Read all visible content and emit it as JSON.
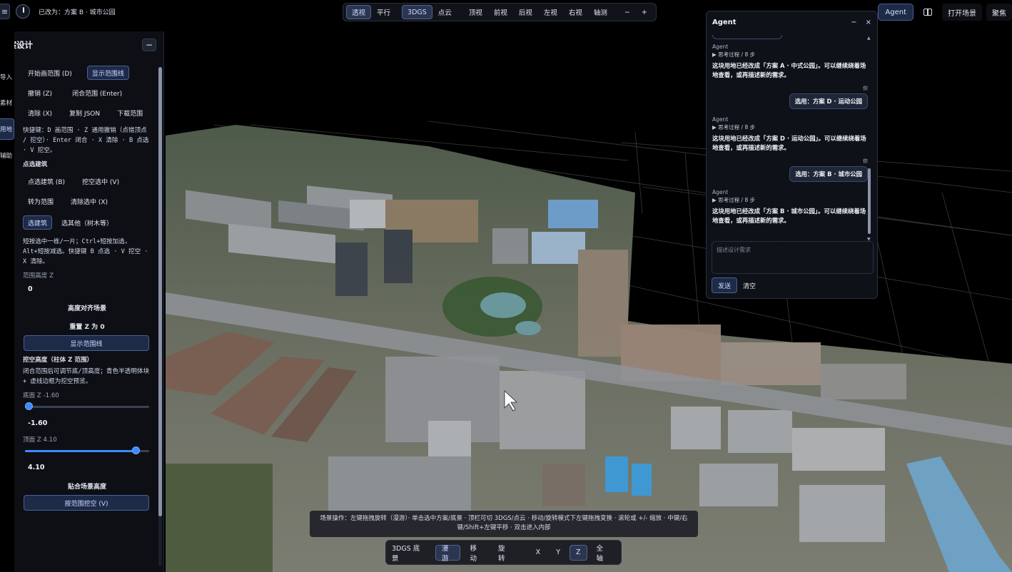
{
  "topbar": {
    "status_text": "已改为：方案 B · 城市公园",
    "view_buttons": [
      {
        "label": "透视",
        "active": true
      },
      {
        "label": "平行",
        "active": false
      },
      {
        "label": "3DGS",
        "active": true
      },
      {
        "label": "点云",
        "active": false
      },
      {
        "label": "顶视",
        "active": false
      },
      {
        "label": "前视",
        "active": false
      },
      {
        "label": "后视",
        "active": false
      },
      {
        "label": "左视",
        "active": false
      },
      {
        "label": "右视",
        "active": false
      },
      {
        "label": "轴测",
        "active": false
      },
      {
        "label": "−",
        "active": false
      },
      {
        "label": "+",
        "active": false
      }
    ],
    "agent_label": "Agent",
    "open_scene_label": "打开场景",
    "focus_label": "聚焦"
  },
  "sidebar_tabs": [
    "导入",
    "素材",
    "用地",
    "辅助"
  ],
  "left_panel": {
    "title": "方案设计",
    "collapse": "−",
    "start_draw": "开始画范围 (D)",
    "show_bounds_top": "显示范围线",
    "undo": "撤销 (Z)",
    "close_range": "闭合范围 (Enter)",
    "clear": "清除 (X)",
    "copy_json": "复制 JSON",
    "download_range": "下载范围",
    "shortcut_hint": "快捷键：D 画范围 · Z 通用撤销（点错顶点 / 挖空）· Enter 闭合 · X 清除 · B 点选 · V 挖空。",
    "pick_building_label": "点选建筑",
    "pick_building": "点选建筑 (B)",
    "hollow_selected": "挖空选中 (V)",
    "to_range": "转为范围",
    "clear_selection": "清除选中 (X)",
    "select_building": "选建筑",
    "select_other": "选其他（树木等）",
    "select_hint": "短按选中一栋/一片；Ctrl+短按加选，Alt+短按减选。快捷键 B 点选 · V 挖空 · X 清除。",
    "range_height_label": "范围高度 Z",
    "range_height_value": "0",
    "align_height": "高度对齐场景",
    "reset_z": "重置 Z 为 0",
    "show_bounds_bottom": "显示范围线",
    "hollow_height_label": "挖空高度（柱体 Z 范围）",
    "hollow_hint": "闭合范围后可调节底/顶高度；青色半透明体块 + 虚线边框为挖空预览。",
    "bottom_z_label": "底面 Z -1.60",
    "bottom_z_value": "-1.60",
    "bottom_z_fraction": 0.0,
    "top_z_label": "顶面 Z 4.10",
    "top_z_value": "4.10",
    "top_z_fraction": 0.92,
    "fit_scene_height": "贴合场景高度",
    "hollow_by_range": "按范围挖空 (V)"
  },
  "agent": {
    "title": "Agent",
    "minimize": "−",
    "close": "×",
    "messages": [
      {
        "role": "agent",
        "who": "Agent",
        "steps": "▶ 思考过程 / 8 步",
        "text": "这块用地已经改成「方案 A · 中式公园」。可以继续绕着场地查看，或再描述新的需求。"
      },
      {
        "role": "user",
        "who": "你",
        "text": "选用：方案 D · 运动公园"
      },
      {
        "role": "agent",
        "who": "Agent",
        "steps": "▶ 思考过程 / 8 步",
        "text": "这块用地已经改成「方案 D · 运动公园」。可以继续绕着场地查看，或再描述新的需求。"
      },
      {
        "role": "user",
        "who": "你",
        "text": "选用：方案 B · 城市公园"
      },
      {
        "role": "agent",
        "who": "Agent",
        "steps": "▶ 思考过程 / 8 步",
        "text": "这块用地已经改成「方案 B · 城市公园」。可以继续绕着场地查看，或再描述新的需求。"
      }
    ],
    "input_placeholder": "描述设计需求",
    "send": "发送",
    "clear": "清空"
  },
  "bottom": {
    "hint": "场景操作：左键拖拽旋转（漫游）· 单击选中方案/底景 · 顶栏可切 3DGS/点云 · 移动/旋转模式下左键拖拽变换 · 滚轮或 +/- 缩放 · 中键/右键/Shift+左键平移 · 双击进入内部",
    "mode_label": "3DGS 底景",
    "buttons": [
      {
        "label": "漫游",
        "active": true
      },
      {
        "label": "移动",
        "active": false
      },
      {
        "label": "旋转",
        "active": false
      },
      {
        "label": "X",
        "active": false
      },
      {
        "label": "Y",
        "active": false
      },
      {
        "label": "Z",
        "active": true
      },
      {
        "label": "全轴",
        "active": false
      }
    ]
  },
  "colors": {
    "accent": "#3d8bff",
    "active_bg": "#1d2a48",
    "panel_bg": "#0e1016"
  }
}
